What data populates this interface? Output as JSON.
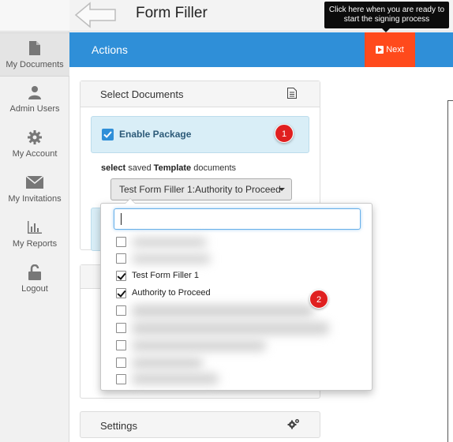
{
  "header": {
    "title": "Form Filler",
    "tooltip_line1": "Click here when you are ready to",
    "tooltip_line2": "start the signing process"
  },
  "actionbar": {
    "label": "Actions",
    "next_label": "Next"
  },
  "sidebar": {
    "items": [
      {
        "label": "My Documents",
        "icon": "document-icon"
      },
      {
        "label": "Admin Users",
        "icon": "user-icon"
      },
      {
        "label": "My Account",
        "icon": "gear-icon"
      },
      {
        "label": "My Invitations",
        "icon": "envelope-icon"
      },
      {
        "label": "My Reports",
        "icon": "bar-chart-icon"
      },
      {
        "label": "Logout",
        "icon": "unlock-icon"
      }
    ]
  },
  "select_panel": {
    "title": "Select Documents",
    "enable_label": "Enable Package",
    "enable_checked": true,
    "select_prefix": "select",
    "select_middle": " saved ",
    "select_bold": "Template",
    "select_suffix": " documents",
    "template_value": "Test Form Filler 1:Authority to Proceed"
  },
  "dropdown": {
    "search_value": "",
    "options": [
      {
        "label": "",
        "checked": false,
        "blurred": true
      },
      {
        "label": "",
        "checked": false,
        "blurred": true
      },
      {
        "label": "Test Form Filler 1",
        "checked": true,
        "blurred": false
      },
      {
        "label": "Authority to Proceed",
        "checked": true,
        "blurred": false
      },
      {
        "label": "",
        "checked": false,
        "blurred": true
      },
      {
        "label": "",
        "checked": false,
        "blurred": true
      },
      {
        "label": "",
        "checked": false,
        "blurred": true
      },
      {
        "label": "",
        "checked": false,
        "blurred": true
      },
      {
        "label": "",
        "checked": false,
        "blurred": true
      }
    ]
  },
  "badges": {
    "one": "1",
    "two": "2"
  },
  "settings": {
    "label": "Settings"
  },
  "colors": {
    "accent": "#2f8fd8",
    "next": "#ff4a1c",
    "badge": "#e02020"
  }
}
